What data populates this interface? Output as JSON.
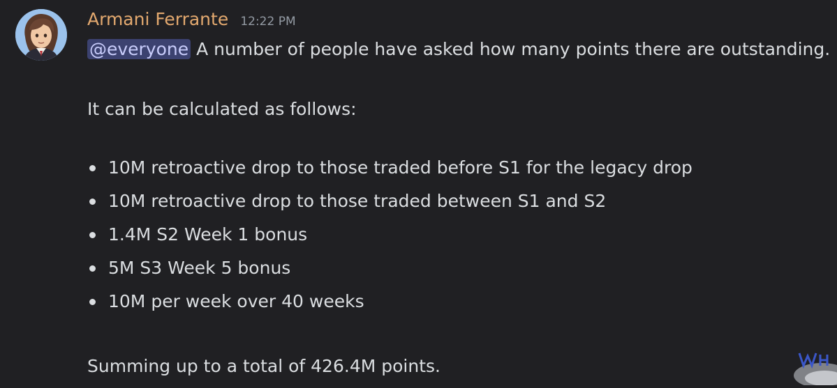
{
  "message": {
    "author": "Armani Ferrante",
    "timestamp": "12:22 PM",
    "mention": "@everyone",
    "first_line": " A number of people have asked how many points there are outstanding.",
    "intro": "It can be calculated as follows:",
    "bullets": [
      "10M retroactive drop to those traded before S1 for the legacy drop",
      "10M retroactive drop to those traded between S1 and S2",
      "1.4M S2 Week 1 bonus",
      "5M S3 Week 5 bonus",
      "10M per week over 40 weeks"
    ],
    "summary": "Summing up to a total of 426.4M points."
  },
  "colors": {
    "background": "#202023",
    "author": "#e3a96f",
    "text": "#dbdee1",
    "mention_bg": "#3c4270",
    "mention_text": "#c9cdfb",
    "timestamp": "#949ba4"
  },
  "icons": {
    "avatar": "user-avatar-illustration",
    "bullet": "bullet-dot",
    "corner": "watermark-badge"
  }
}
